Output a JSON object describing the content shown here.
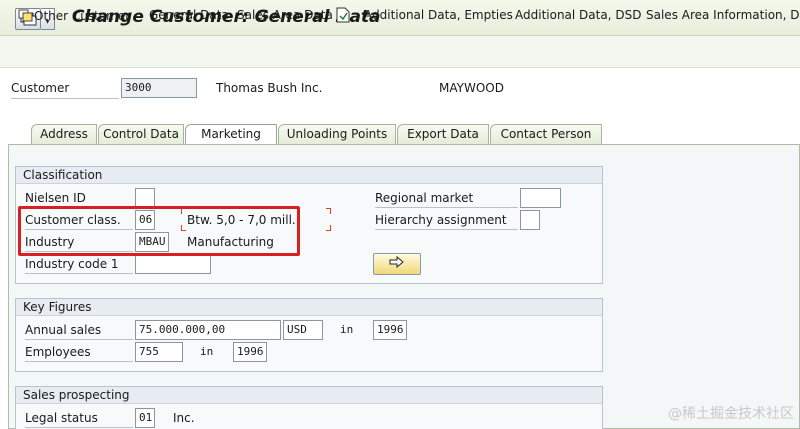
{
  "window": {
    "title": "Change Customer: General Data"
  },
  "toolbar": {
    "other_customer": "Other Customer",
    "general_data": "General Data",
    "sales_area_data": "Sales Area Data",
    "additional_empties": "Additional Data, Empties",
    "additional_dsd": "Additional Data, DSD",
    "sales_area_info": "Sales Area Information, DSD"
  },
  "header": {
    "customer_label": "Customer",
    "customer_number": "3000",
    "customer_name": "Thomas Bush Inc.",
    "city": "MAYWOOD"
  },
  "tabs": [
    "Address",
    "Control Data",
    "Marketing",
    "Unloading Points",
    "Export Data",
    "Contact Person"
  ],
  "active_tab": "Marketing",
  "classification": {
    "title": "Classification",
    "nielsen_label": "Nielsen ID",
    "nielsen_value": "",
    "customer_class_label": "Customer class.",
    "customer_class_value": "06",
    "customer_class_desc": "Btw. 5,0 - 7,0 mill.",
    "industry_label": "Industry",
    "industry_value": "MBAU",
    "industry_desc": "Manufacturing",
    "industry_code_label": "Industry code 1",
    "industry_code_value": "",
    "regional_market_label": "Regional market",
    "regional_market_value": "",
    "hierarchy_label": "Hierarchy assignment",
    "hierarchy_value": ""
  },
  "key_figures": {
    "title": "Key Figures",
    "annual_sales_label": "Annual sales",
    "annual_sales_value": "75.000.000,00",
    "currency": "USD",
    "in_label": "in",
    "annual_sales_year": "1996",
    "employees_label": "Employees",
    "employees_value": "755",
    "employees_year": "1996"
  },
  "sales_prospecting": {
    "title": "Sales prospecting",
    "legal_status_label": "Legal status",
    "legal_status_value": "01",
    "legal_status_desc": "Inc."
  },
  "watermark": "@稀土掘金技术社区",
  "colors": {
    "highlight": "#d92020",
    "accent_button": "#f0d878"
  }
}
